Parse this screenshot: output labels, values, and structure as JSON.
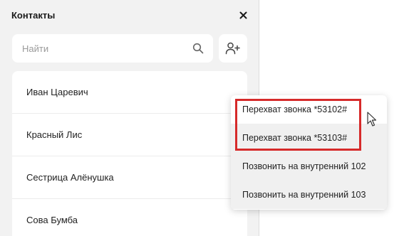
{
  "panel": {
    "title": "Контакты",
    "close_icon": "close-icon",
    "search": {
      "placeholder": "Найти",
      "icon": "search-icon"
    },
    "add_contact_icon": "add-person-icon"
  },
  "contacts": [
    {
      "name": "Иван Царевич"
    },
    {
      "name": "Красный Лис"
    },
    {
      "name": "Сестрица Алёнушка"
    },
    {
      "name": "Сова Бумба"
    }
  ],
  "context_menu": {
    "items": [
      {
        "label": "Перехват звонка *53102#"
      },
      {
        "label": "Перехват звонка *53103#"
      },
      {
        "label": "Позвонить на внутренний 102"
      },
      {
        "label": "Позвонить на внутренний 103"
      }
    ]
  },
  "colors": {
    "highlight_border": "#d62a2a",
    "panel_background": "#f2f2f2"
  }
}
